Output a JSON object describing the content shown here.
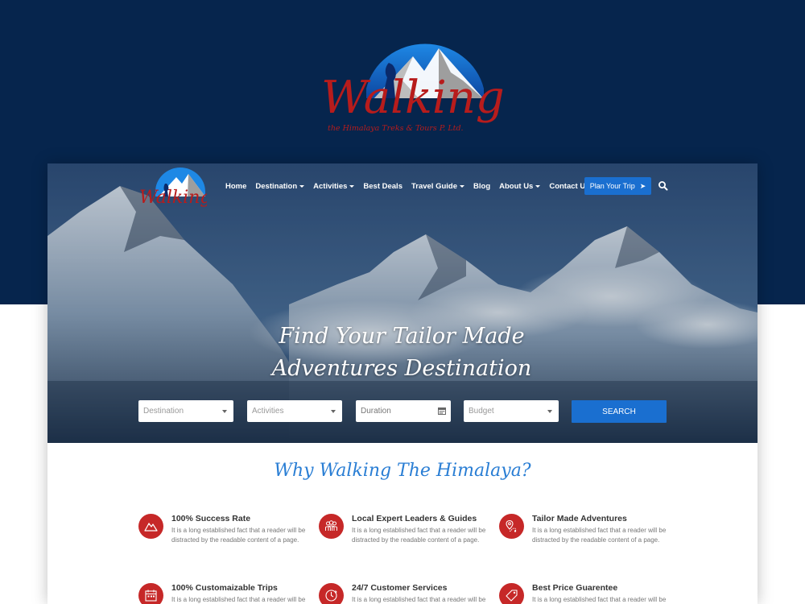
{
  "colors": {
    "background": "#06254d",
    "accent": "#1a6fd0",
    "title_blue": "#2a7ed4",
    "icon_red": "#c62828",
    "logo_red": "#b71c1c"
  },
  "logo": {
    "name": "Walking",
    "tagline": "the Himalaya Treks & Tours P. Ltd."
  },
  "nav": {
    "items": [
      {
        "label": "Home",
        "dropdown": false
      },
      {
        "label": "Destination",
        "dropdown": true
      },
      {
        "label": "Activities",
        "dropdown": true
      },
      {
        "label": "Best Deals",
        "dropdown": false
      },
      {
        "label": "Travel Guide",
        "dropdown": true
      },
      {
        "label": "Blog",
        "dropdown": false
      },
      {
        "label": "About Us",
        "dropdown": true
      },
      {
        "label": "Contact Us",
        "dropdown": false
      }
    ],
    "plan_button": "Plan Your Trip",
    "plan_icon": "paper-plane-icon",
    "search_icon": "search-icon"
  },
  "hero": {
    "title_line1": "Find Your Tailor Made",
    "title_line2": "Adventures Destination"
  },
  "search_form": {
    "destination": "Destination",
    "activities": "Activities",
    "duration": "Duration",
    "budget": "Budget",
    "button": "SEARCH"
  },
  "why": {
    "title": "Why Walking The Himalaya?",
    "features": [
      {
        "title": "100% Success Rate",
        "icon": "mountain-icon",
        "desc": "It is a long established fact that a reader will be distracted by the readable content of a page."
      },
      {
        "title": "Local Expert Leaders & Guides",
        "icon": "group-icon",
        "desc": "It is a long established fact that a reader will be distracted by the readable content of a page."
      },
      {
        "title": "Tailor Made Adventures",
        "icon": "map-pin-icon",
        "desc": "It is a long established fact that a reader will be distracted by the readable content of a page."
      },
      {
        "title": "100% Customaizable Trips",
        "icon": "calendar-icon",
        "desc": "It is a long established fact that a reader will be distracted by the readable content of a page."
      },
      {
        "title": "24/7 Customer Services",
        "icon": "clock-24-icon",
        "desc": "It is a long established fact that a reader will be distracted by the readable content of a page."
      },
      {
        "title": "Best Price Guarentee",
        "icon": "price-tag-icon",
        "desc": "It is a long established fact that a reader will be distracted by the readable content of a page."
      }
    ]
  }
}
